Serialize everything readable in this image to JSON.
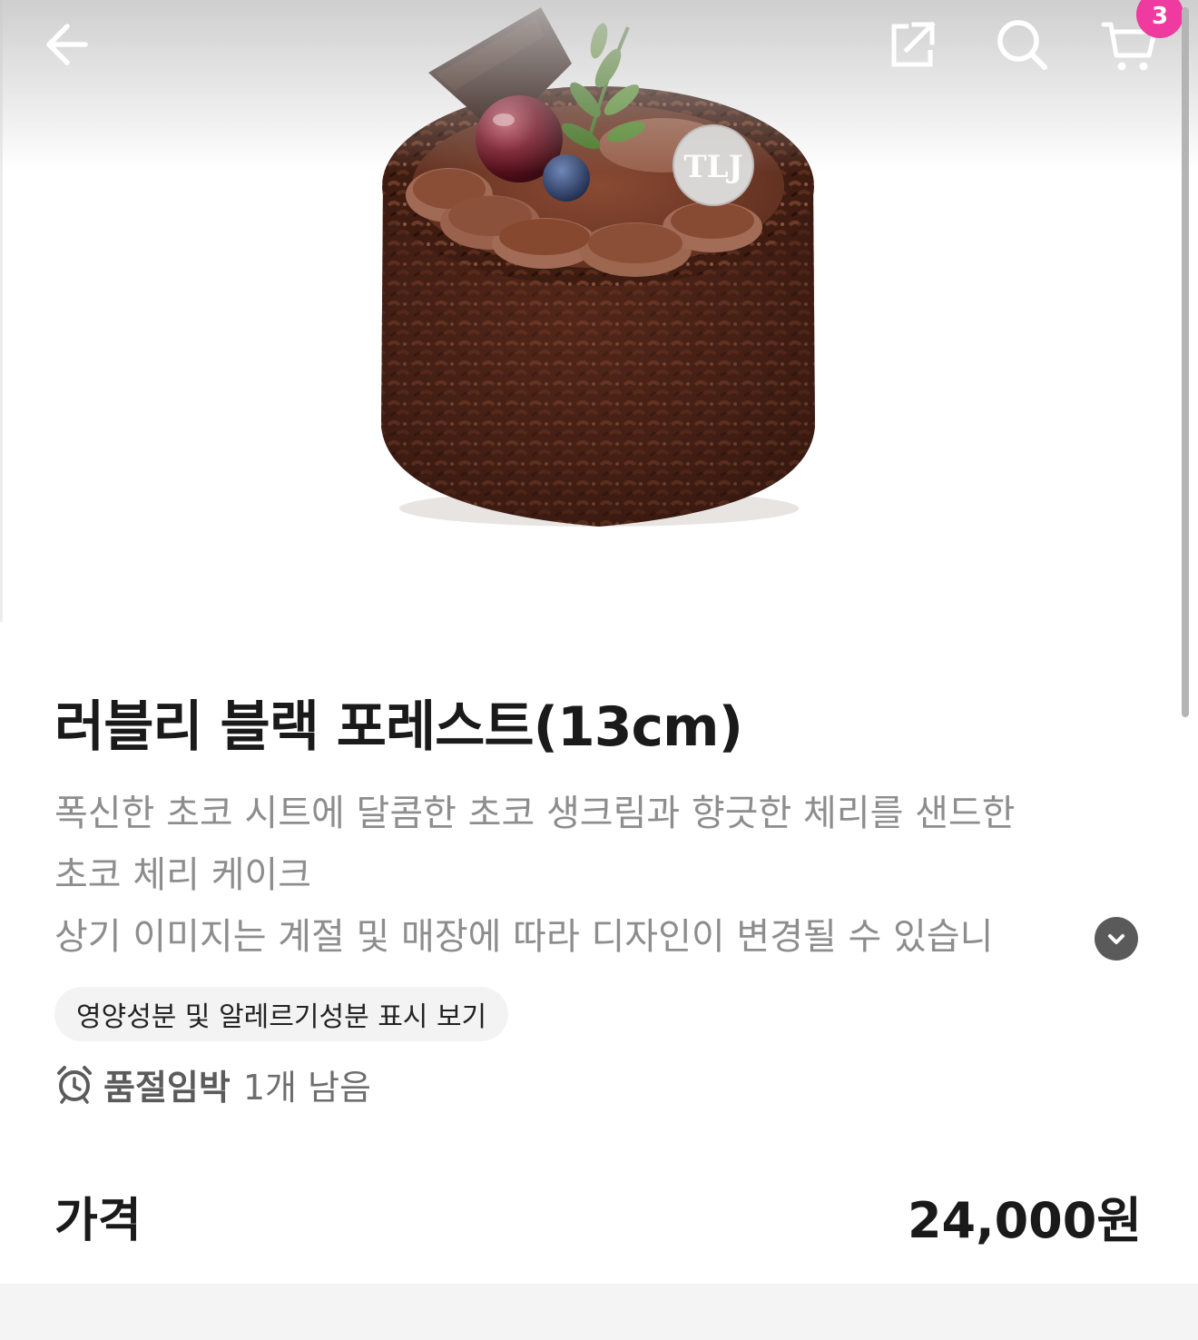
{
  "header": {
    "back_icon": "arrow-left-icon",
    "share_icon": "share-external-icon",
    "search_icon": "search-icon",
    "cart_icon": "cart-icon",
    "cart_count": "3",
    "badge_color": "#ef3aa0"
  },
  "product": {
    "image_icon": "cake-photo",
    "title": "러블리 블랙 포레스트(13cm)",
    "description_lines": [
      "폭신한 초코 시트에 달콤한 초코 생크림과 향긋한 체리를 샌드한",
      "초코 체리 케이크",
      "상기 이미지는 계절 및 매장에 따라 디자인이 변경될 수 있습니"
    ],
    "expand_icon": "chevron-down-icon",
    "nutrition_button": "영양성분 및 알레르기성분 표시 보기",
    "stock_icon": "alarm-clock-icon",
    "stock_warning": "품절임박",
    "stock_count": "1개 남음",
    "price_label": "가격",
    "price": "24,000원"
  }
}
